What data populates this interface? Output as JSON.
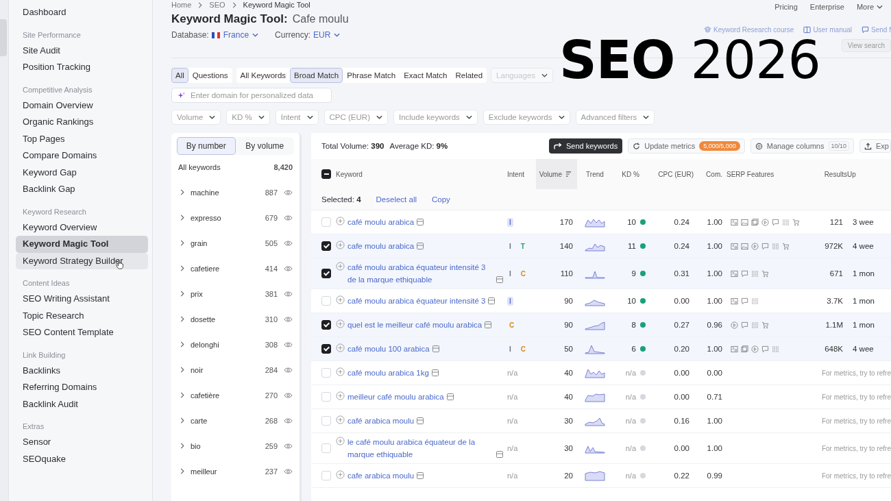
{
  "breadcrumbs": [
    "Home",
    "SEO",
    "Keyword Magic Tool"
  ],
  "top_nav": [
    "Pricing",
    "Enterprise",
    "More"
  ],
  "sidebar": {
    "groups": [
      {
        "items": [
          {
            "label": "Dashboard",
            "selected": false,
            "hovered": false
          }
        ]
      },
      {
        "heading": "Site Performance",
        "items": [
          {
            "label": "Site Audit",
            "selected": false,
            "hovered": false
          },
          {
            "label": "Position Tracking",
            "selected": false,
            "hovered": false
          }
        ]
      },
      {
        "heading": "Competitive Analysis",
        "items": [
          {
            "label": "Domain Overview",
            "selected": false,
            "hovered": false
          },
          {
            "label": "Organic Rankings",
            "selected": false,
            "hovered": false
          },
          {
            "label": "Top Pages",
            "selected": false,
            "hovered": false
          },
          {
            "label": "Compare Domains",
            "selected": false,
            "hovered": false
          },
          {
            "label": "Keyword Gap",
            "selected": false,
            "hovered": false
          },
          {
            "label": "Backlink Gap",
            "selected": false,
            "hovered": false
          }
        ]
      },
      {
        "heading": "Keyword Research",
        "items": [
          {
            "label": "Keyword Overview",
            "selected": false,
            "hovered": false
          },
          {
            "label": "Keyword Magic Tool",
            "selected": true,
            "hovered": false
          },
          {
            "label": "Keyword Strategy Builder",
            "selected": false,
            "hovered": true
          }
        ]
      },
      {
        "heading": "Content Ideas",
        "items": [
          {
            "label": "SEO Writing Assistant",
            "selected": false,
            "hovered": false
          },
          {
            "label": "Topic Research",
            "selected": false,
            "hovered": false
          },
          {
            "label": "SEO Content Template",
            "selected": false,
            "hovered": false
          }
        ]
      },
      {
        "heading": "Link Building",
        "items": [
          {
            "label": "Backlinks",
            "selected": false,
            "hovered": false
          },
          {
            "label": "Referring Domains",
            "selected": false,
            "hovered": false
          },
          {
            "label": "Backlink Audit",
            "selected": false,
            "hovered": false
          }
        ]
      },
      {
        "heading": "Extras",
        "items": [
          {
            "label": "Sensor",
            "selected": false,
            "hovered": false
          },
          {
            "label": "SEOquake",
            "selected": false,
            "hovered": false
          }
        ]
      }
    ]
  },
  "page": {
    "title": "Keyword Magic Tool:",
    "query": "Cafe moulu",
    "database_label": "Database:",
    "database": "France",
    "currency_label": "Currency:",
    "currency": "EUR"
  },
  "help_links": [
    {
      "label": "Keyword Research course",
      "kind": "course"
    },
    {
      "label": "User manual",
      "kind": "manual"
    },
    {
      "label": "Send f",
      "kind": "feedback"
    }
  ],
  "view_search_button": "View search",
  "overlay_title": "**SEO** 2026",
  "scope_tabs": [
    {
      "label": "All",
      "selected": true
    },
    {
      "label": "Questions",
      "selected": false
    }
  ],
  "match_tabs": [
    {
      "label": "All Keywords",
      "selected": false
    },
    {
      "label": "Broad Match",
      "selected": true
    },
    {
      "label": "Phrase Match",
      "selected": false
    },
    {
      "label": "Exact Match",
      "selected": false
    },
    {
      "label": "Related",
      "selected": false
    }
  ],
  "languages": "Languages",
  "domain_field": {
    "placeholder": "Enter domain for personalized data"
  },
  "filters": [
    "Volume",
    "KD %",
    "Intent",
    "CPC (EUR)",
    "Include keywords",
    "Exclude keywords",
    "Advanced filters"
  ],
  "group_sort": [
    {
      "label": "By number",
      "selected": true
    },
    {
      "label": "By volume",
      "selected": false
    }
  ],
  "groups": {
    "all_label": "All keywords",
    "all_count": "8,420",
    "items": [
      {
        "name": "machine",
        "count": "887"
      },
      {
        "name": "expresso",
        "count": "679"
      },
      {
        "name": "grain",
        "count": "505"
      },
      {
        "name": "cafetiere",
        "count": "414"
      },
      {
        "name": "prix",
        "count": "381"
      },
      {
        "name": "dosette",
        "count": "310"
      },
      {
        "name": "delonghi",
        "count": "308"
      },
      {
        "name": "noir",
        "count": "284"
      },
      {
        "name": "cafetière",
        "count": "270"
      },
      {
        "name": "carte",
        "count": "268"
      },
      {
        "name": "bio",
        "count": "259"
      },
      {
        "name": "meilleur",
        "count": "237"
      }
    ]
  },
  "totals": {
    "volume_label": "Total Volume:",
    "volume": "390",
    "kd_label": "Average KD:",
    "kd": "9%"
  },
  "actions": {
    "send": "Send keywords",
    "update": "Update metrics",
    "update_badge": "5,000/5,000",
    "manage": "Manage columns",
    "manage_count": "10/10",
    "export": "Exp"
  },
  "table": {
    "header_indeterminate": true,
    "columns": [
      {
        "label": "Keyword",
        "sorted": false
      },
      {
        "label": "Intent",
        "sorted": false
      },
      {
        "label": "Volume",
        "sorted": true
      },
      {
        "label": "Trend",
        "sorted": false
      },
      {
        "label": "KD %",
        "sorted": false
      },
      {
        "label": "CPC (EUR)",
        "sorted": false
      },
      {
        "label": "Com.",
        "sorted": false
      },
      {
        "label": "SERP Features",
        "sorted": false
      },
      {
        "label": "Results",
        "sorted": false
      },
      {
        "label": "Up",
        "sorted": false
      }
    ],
    "selection": {
      "label": "Selected:",
      "count": "4",
      "deselect": "Deselect all",
      "copy": "Copy"
    },
    "rows": [
      {
        "checked": false,
        "keyword": "café moulu arabica",
        "intents": [
          {
            "label": "I",
            "color": "#5b6fd6",
            "highlighted": true
          }
        ],
        "volume": "170",
        "kd": "10",
        "color": "#1aa179",
        "cpc": "0.24",
        "com": "1.00",
        "serp": [
          {
            "kind": "snippet"
          },
          {
            "kind": "image"
          },
          {
            "kind": "gallery"
          },
          {
            "kind": "video"
          },
          {
            "kind": "review"
          },
          {
            "kind": "sitelinks"
          },
          {
            "kind": "shopping"
          }
        ],
        "results": "121",
        "updated": "3 wee"
      },
      {
        "checked": true,
        "keyword": "cafe moulu arabica",
        "intents": [
          {
            "label": "I",
            "color": "#6b6f80",
            "highlighted": false
          },
          {
            "label": "T",
            "color": "#2f9e6e",
            "highlighted": false
          }
        ],
        "volume": "140",
        "kd": "11",
        "color": "#1aa179",
        "cpc": "0.24",
        "com": "1.00",
        "serp": [
          {
            "kind": "snippet"
          },
          {
            "kind": "image"
          },
          {
            "kind": "video"
          },
          {
            "kind": "review"
          },
          {
            "kind": "sitelinks"
          },
          {
            "kind": "shopping"
          }
        ],
        "results": "972K",
        "updated": "4 wee"
      },
      {
        "checked": true,
        "keyword": "café moulu arabica équateur intensité 3 de la marque ethiquable",
        "intents": [
          {
            "label": "I",
            "color": "#6b6f80",
            "highlighted": false
          },
          {
            "label": "C",
            "color": "#d88a1c",
            "highlighted": false
          }
        ],
        "volume": "110",
        "kd": "9",
        "color": "#1aa179",
        "cpc": "0.31",
        "com": "1.00",
        "serp": [
          {
            "kind": "snippet"
          },
          {
            "kind": "review"
          },
          {
            "kind": "sitelinks"
          },
          {
            "kind": "shopping"
          }
        ],
        "results": "671",
        "updated": "1 mon"
      },
      {
        "checked": false,
        "keyword": "café moulu arabica équateur intensité 3",
        "intents": [
          {
            "label": "I",
            "color": "#5b6fd6",
            "highlighted": true
          }
        ],
        "volume": "90",
        "kd": "10",
        "color": "#1aa179",
        "cpc": "0.00",
        "com": "1.00",
        "serp": [
          {
            "kind": "snippet"
          },
          {
            "kind": "review"
          },
          {
            "kind": "sitelinks"
          }
        ],
        "results": "3.7K",
        "updated": "1 mon"
      },
      {
        "checked": true,
        "keyword": "quel est le meilleur café moulu arabica",
        "intents": [
          {
            "label": "C",
            "color": "#d88a1c",
            "highlighted": false
          }
        ],
        "volume": "90",
        "kd": "8",
        "color": "#1aa179",
        "cpc": "0.27",
        "com": "0.96",
        "serp": [
          {
            "kind": "video"
          },
          {
            "kind": "review"
          },
          {
            "kind": "sitelinks"
          },
          {
            "kind": "shopping"
          }
        ],
        "results": "1.1M",
        "updated": "1 mon"
      },
      {
        "checked": true,
        "keyword": "café moulu 100 arabica",
        "intents": [
          {
            "label": "I",
            "color": "#6b6f80",
            "highlighted": false
          },
          {
            "label": "C",
            "color": "#d88a1c",
            "highlighted": false
          }
        ],
        "volume": "50",
        "kd": "6",
        "color": "#1aa179",
        "cpc": "0.20",
        "com": "1.00",
        "serp": [
          {
            "kind": "snippet"
          },
          {
            "kind": "gallery"
          },
          {
            "kind": "video"
          },
          {
            "kind": "review"
          },
          {
            "kind": "sitelinks"
          }
        ],
        "results": "648K",
        "updated": "4 wee"
      },
      {
        "checked": false,
        "keyword": "café moulu arabica 1kg",
        "intent_text": "n/a",
        "volume": "40",
        "kd": "n/a",
        "color": "#d6d8de",
        "cpc": "0.00",
        "com": "0.00",
        "note": "For metrics, try to refre"
      },
      {
        "checked": false,
        "keyword": "meilleur café moulu arabica",
        "intent_text": "n/a",
        "volume": "40",
        "kd": "n/a",
        "color": "#d6d8de",
        "cpc": "0.00",
        "com": "0.71",
        "note": "For metrics, try to refre"
      },
      {
        "checked": false,
        "keyword": "café arabica moulu",
        "intent_text": "n/a",
        "volume": "30",
        "kd": "n/a",
        "color": "#d6d8de",
        "cpc": "0.16",
        "com": "1.00",
        "note": "For metrics, try to refre"
      },
      {
        "checked": false,
        "keyword": "le café moulu arabica équateur de la marque ethiquable",
        "intent_text": "n/a",
        "volume": "30",
        "kd": "n/a",
        "color": "#d6d8de",
        "cpc": "0.00",
        "com": "1.00",
        "note": "For metrics, try to refre"
      },
      {
        "checked": false,
        "keyword": "cafe arabica moulu",
        "intent_text": "n/a",
        "volume": "20",
        "kd": "n/a",
        "color": "#d6d8de",
        "cpc": "0.22",
        "com": "0.99",
        "note": "For metrics, try to refre"
      }
    ]
  }
}
